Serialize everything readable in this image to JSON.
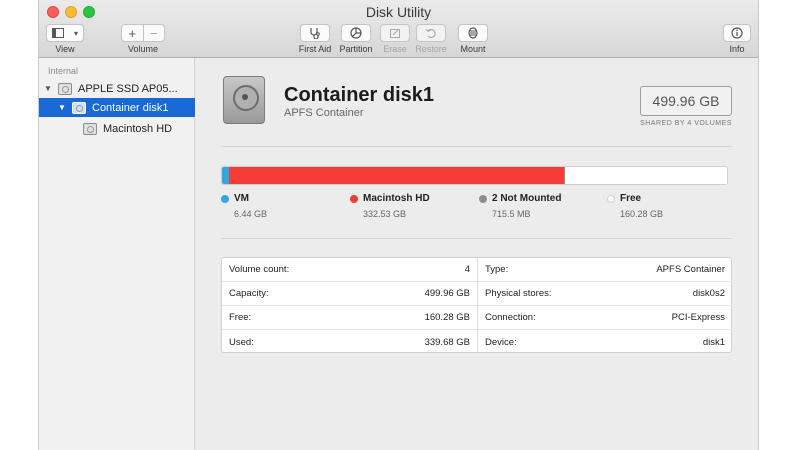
{
  "window": {
    "title": "Disk Utility"
  },
  "toolbar": {
    "view_label": "View",
    "volume_label": "Volume",
    "volume_add": "+",
    "volume_remove": "−",
    "first_aid_label": "First Aid",
    "partition_label": "Partition",
    "erase_label": "Erase",
    "restore_label": "Restore",
    "mount_label": "Mount",
    "info_label": "Info"
  },
  "sidebar": {
    "section": "Internal",
    "items": [
      {
        "label": "APPLE SSD AP05...",
        "level": 0,
        "expanded": true,
        "selected": false
      },
      {
        "label": "Container disk1",
        "level": 1,
        "expanded": true,
        "selected": true
      },
      {
        "label": "Macintosh HD",
        "level": 2,
        "expanded": false,
        "selected": false
      }
    ]
  },
  "main": {
    "name": "Container disk1",
    "subtitle": "APFS Container",
    "capacity": "499.96 GB",
    "shared_note": "SHARED BY 4 VOLUMES",
    "usage": [
      {
        "name": "VM",
        "size": "6.44 GB",
        "color": "#2fa8e0",
        "fraction": 0.0129
      },
      {
        "name": "Macintosh HD",
        "size": "332.53 GB",
        "color": "#f23c35",
        "fraction": 0.6651
      },
      {
        "name": "2 Not Mounted",
        "size": "715.5 MB",
        "color": "#8e8e8e",
        "fraction": 0.0014
      },
      {
        "name": "Free",
        "size": "160.28 GB",
        "color": "#ffffff",
        "fraction": 0.3206
      }
    ],
    "info_left": [
      {
        "label": "Volume count:",
        "value": "4"
      },
      {
        "label": "Capacity:",
        "value": "499.96 GB"
      },
      {
        "label": "Free:",
        "value": "160.28 GB"
      },
      {
        "label": "Used:",
        "value": "339.68 GB"
      }
    ],
    "info_right": [
      {
        "label": "Type:",
        "value": "APFS Container"
      },
      {
        "label": "Physical stores:",
        "value": "disk0s2"
      },
      {
        "label": "Connection:",
        "value": "PCI-Express"
      },
      {
        "label": "Device:",
        "value": "disk1"
      }
    ]
  }
}
